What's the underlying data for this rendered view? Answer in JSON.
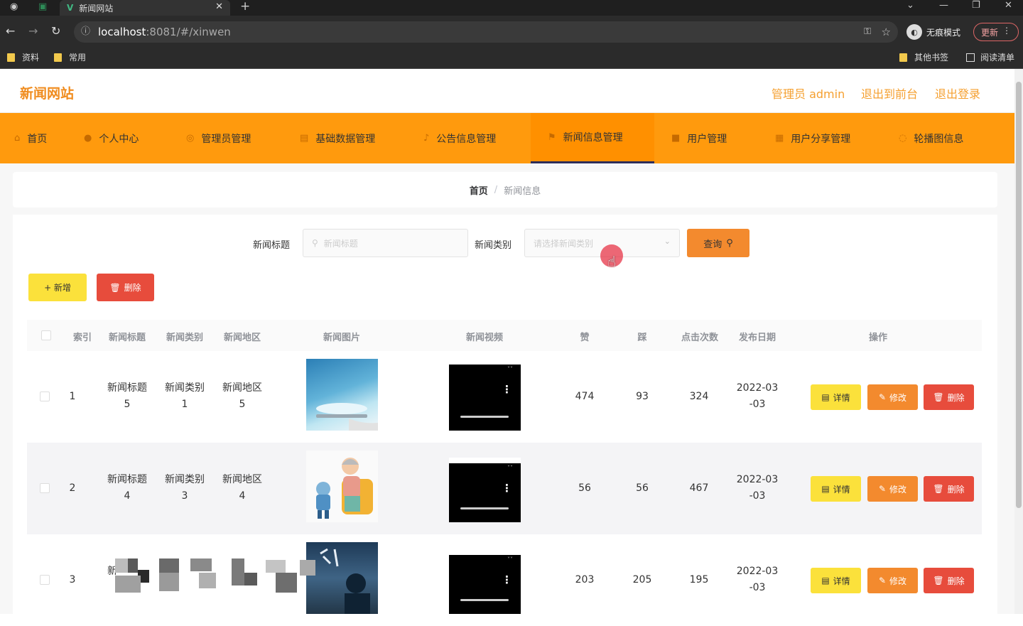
{
  "browser": {
    "tab_title": "新闻网站",
    "tab_logo": "V",
    "url_host": "localhost",
    "url_rest": ":8081/#/xinwen",
    "incognito_label": "无痕模式",
    "update_label": "更新",
    "bookmarks": [
      "资料",
      "常用"
    ],
    "other_bookmarks": "其他书签",
    "reading_list": "阅读清单"
  },
  "header": {
    "brand": "新闻网站",
    "admin": "管理员 admin",
    "exit_front": "退出到前台",
    "logout": "退出登录"
  },
  "nav": {
    "items": [
      {
        "label": "首页"
      },
      {
        "label": "个人中心"
      },
      {
        "label": "管理员管理"
      },
      {
        "label": "基础数据管理"
      },
      {
        "label": "公告信息管理"
      },
      {
        "label": "新闻信息管理"
      },
      {
        "label": "用户管理"
      },
      {
        "label": "用户分享管理"
      },
      {
        "label": "轮播图信息"
      }
    ],
    "active_index": 5
  },
  "breadcrumb": {
    "home": "首页",
    "sep": "/",
    "current": "新闻信息"
  },
  "filters": {
    "title_label": "新闻标题",
    "title_placeholder": "新闻标题",
    "type_label": "新闻类别",
    "type_placeholder": "请选择新闻类别",
    "query_label": "查询"
  },
  "actions": {
    "add_label": "+ 新增",
    "delete_label": "删除"
  },
  "table": {
    "headers": [
      "索引",
      "新闻标题",
      "新闻类别",
      "新闻地区",
      "新闻图片",
      "新闻视频",
      "赞",
      "踩",
      "点击次数",
      "发布日期",
      "操作"
    ],
    "rows": [
      {
        "index": "1",
        "title1": "新闻标题",
        "title2": "5",
        "type1": "新闻类别",
        "type2": "1",
        "area1": "新闻地区",
        "area2": "5",
        "likes": "474",
        "dislikes": "93",
        "clicks": "324",
        "date1": "2022-03",
        "date2": "-03"
      },
      {
        "index": "2",
        "title1": "新闻标题",
        "title2": "4",
        "type1": "新闻类别",
        "type2": "3",
        "area1": "新闻地区",
        "area2": "4",
        "likes": "56",
        "dislikes": "56",
        "clicks": "467",
        "date1": "2022-03",
        "date2": "-03"
      },
      {
        "index": "3",
        "title1": "新",
        "likes": "203",
        "dislikes": "205",
        "clicks": "195",
        "date1": "2022-03",
        "date2": "-03"
      }
    ],
    "op_detail": "详情",
    "op_edit": "修改",
    "op_delete": "删除"
  },
  "colors": {
    "accent": "#ff9a0d",
    "brand": "#f08c1e",
    "yellow": "#fbe13b",
    "orange": "#f38a2e",
    "red": "#e74c3c"
  }
}
